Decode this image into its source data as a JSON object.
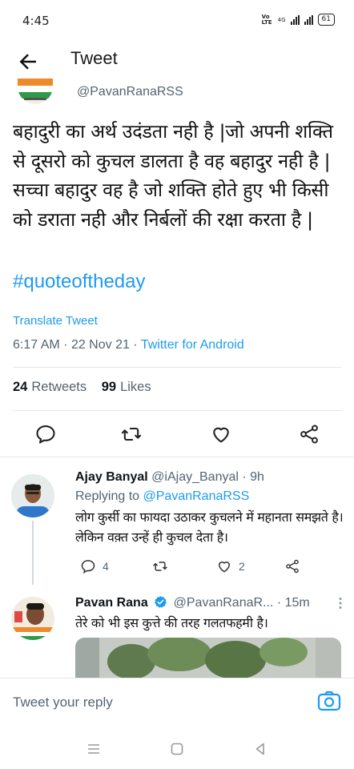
{
  "status_bar": {
    "time": "4:45",
    "network": "Vo LTE",
    "signal_label": "4G",
    "battery": "61"
  },
  "header": {
    "title": "Tweet"
  },
  "tweet": {
    "handle": "@PavanRanaRSS",
    "text": "बहादुरी का अर्थ उदंडता नही है |जो अपनी शक्ति से दूसरो को कुचल डालता है वह बहादुर नही है |सच्चा बहादुर वह है जो शक्ति होते हुए भी किसी को डराता नही और निर्बलों की रक्षा करता है |",
    "hashtag": "#quoteoftheday",
    "translate": "Translate Tweet",
    "time": "6:17 AM",
    "date": "22 Nov 21",
    "source": "Twitter for Android",
    "retweets_count": "24",
    "retweets_label": "Retweets",
    "likes_count": "99",
    "likes_label": "Likes"
  },
  "replies": [
    {
      "name": "Ajay Banyal",
      "handle": "@iAjay_Banyal",
      "time": "9h",
      "replying_prefix": "Replying to",
      "replying_to": "@PavanRanaRSS",
      "text": "लोग कुर्सी का फायदा उठाकर कुचलने में महानता समझते है। लेकिन वक़्त उन्हें ही कुचल देता है।",
      "reply_count": "4",
      "like_count": "2"
    },
    {
      "name": "Pavan Rana",
      "handle": "@PavanRanaR...",
      "time": "15m",
      "text": "तेरे को भी इस कुत्ते की तरह गलतफहमी है।"
    }
  ],
  "compose": {
    "placeholder": "Tweet your reply"
  },
  "colors": {
    "accent": "#1d9bf0",
    "secondary_text": "#536471",
    "primary_text": "#0f1419"
  }
}
